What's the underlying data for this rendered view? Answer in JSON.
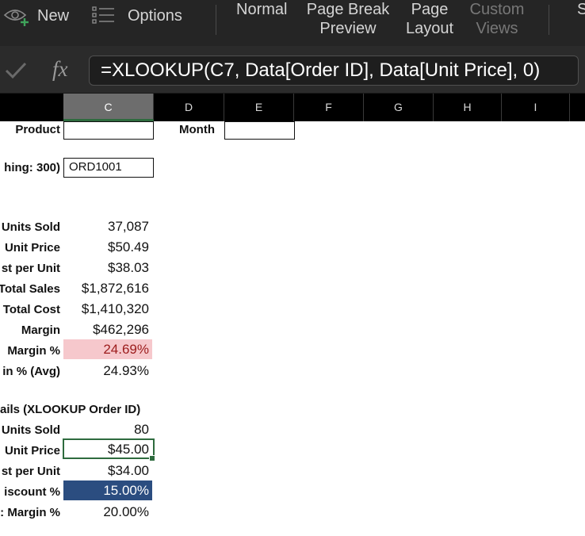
{
  "ribbon": {
    "new_label": "New",
    "options_label": "Options",
    "normal_label": "Normal",
    "page_break_line1": "Page Break",
    "page_break_line2": "Preview",
    "page_layout_line1": "Page",
    "page_layout_line2": "Layout",
    "custom_views_line1": "Custom",
    "custom_views_line2": "Views",
    "cut_off_label": "S"
  },
  "formula_bar": {
    "fx_label": "fx",
    "formula": "=XLOOKUP(C7, Data[Order ID], Data[Unit Price], 0)"
  },
  "columns": [
    "C",
    "D",
    "E",
    "F",
    "G",
    "H",
    "I"
  ],
  "selected_column": "C",
  "top_fields": {
    "product_label": "Product",
    "month_label": "Month",
    "order_lookup_label": "hing: 300)",
    "order_id_value": "ORD1001"
  },
  "summary": [
    {
      "label": "Units Sold",
      "value": "37,087"
    },
    {
      "label": "Unit Price",
      "value": "$50.49"
    },
    {
      "label": "st per Unit",
      "value": "$38.03"
    },
    {
      "label": "Total Sales",
      "value": "$1,872,616"
    },
    {
      "label": "Total Cost",
      "value": "$1,410,320"
    },
    {
      "label": "Margin",
      "value": "$462,296"
    },
    {
      "label": "Margin %",
      "value": "24.69%"
    },
    {
      "label": "in % (Avg)",
      "value": "24.93%"
    }
  ],
  "details": {
    "header": "ails (XLOOKUP Order ID)",
    "rows": [
      {
        "label": "Units Sold",
        "value": "80"
      },
      {
        "label": "Unit Price",
        "value": "$45.00"
      },
      {
        "label": "st per Unit",
        "value": "$34.00"
      },
      {
        "label": "iscount %",
        "value": "15.00%"
      },
      {
        "label": ": Margin %",
        "value": "20.00%"
      }
    ]
  },
  "colors": {
    "ribbon_bg": "#252525",
    "margin_highlight_bg": "#f6c8cc",
    "margin_highlight_text": "#9c1c1c",
    "discount_fill": "#2b4d80",
    "selection_border": "#2e6b3e"
  }
}
